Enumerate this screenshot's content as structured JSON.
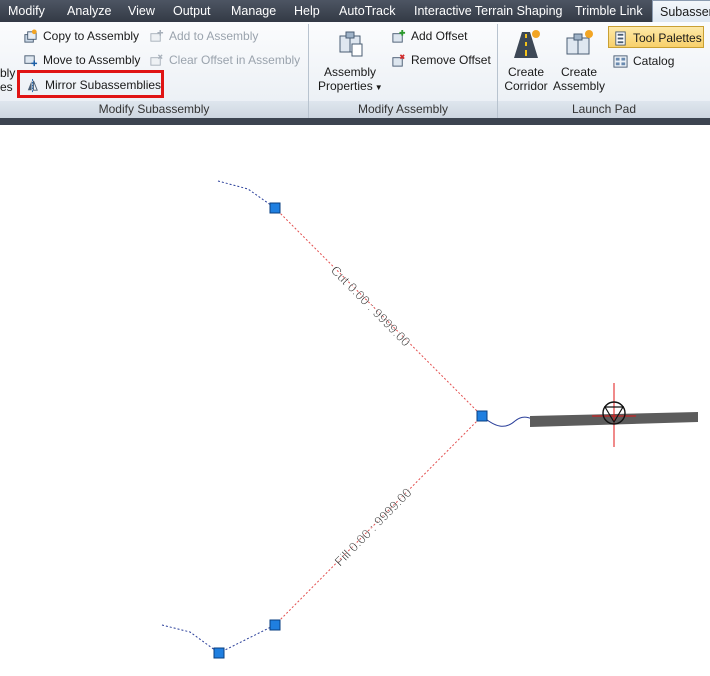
{
  "menu": {
    "tabs": [
      {
        "label": "Modify"
      },
      {
        "label": "Analyze"
      },
      {
        "label": "View"
      },
      {
        "label": "Output"
      },
      {
        "label": "Manage"
      },
      {
        "label": "Help"
      },
      {
        "label": "AutoTrack"
      },
      {
        "label": "Interactive Terrain Shaping"
      },
      {
        "label": "Trimble Link"
      },
      {
        "label": "Subassem"
      }
    ],
    "active_tab": "Subassem"
  },
  "ribbon": {
    "cut_left_top": "bly",
    "cut_left_bottom": "es",
    "modify_subassembly": {
      "title": "Modify Subassembly",
      "copy": "Copy to Assembly",
      "move": "Move to Assembly",
      "mirror": "Mirror Subassemblies",
      "add": "Add to Assembly",
      "clear": "Clear Offset in Assembly"
    },
    "modify_assembly": {
      "title": "Modify Assembly",
      "properties_line1": "Assembly",
      "properties_line2": "Properties",
      "add_offset": "Add Offset",
      "remove_offset": "Remove Offset"
    },
    "launch_pad": {
      "title": "Launch Pad",
      "create_corridor_line1": "Create",
      "create_corridor_line2": "Corridor",
      "create_assembly_line1": "Create",
      "create_assembly_line2": "Assembly",
      "tool_palettes": "Tool Palettes",
      "catalog": "Catalog"
    }
  },
  "drawing": {
    "cut_label": "Cut 0.00 : 9999.00",
    "fill_label": "Fill 0.00 : 9999.00"
  },
  "colors": {
    "grip": "#1f7fe0",
    "crosshair": "#e01414",
    "highlight": "#e01414",
    "dashed_line": "#e34f4f"
  }
}
